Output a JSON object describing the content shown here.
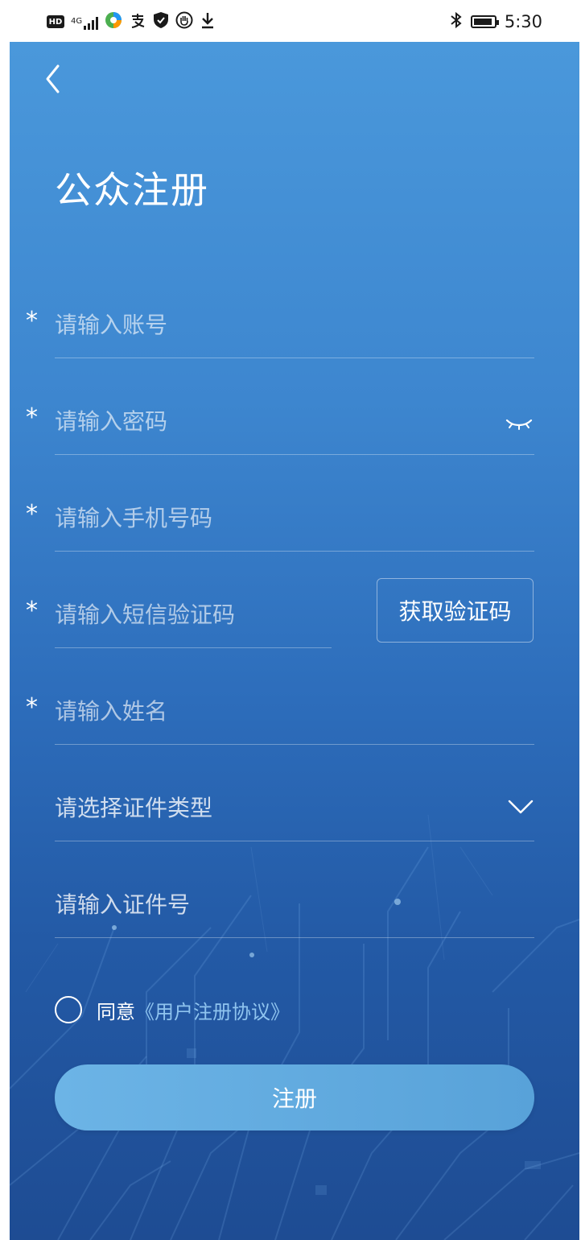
{
  "status_bar": {
    "hd_label": "HD",
    "network_label": "4G",
    "time": "5:30",
    "icons": [
      "hd-icon",
      "signal-icon",
      "app-icon",
      "alipay-icon",
      "shield-icon",
      "hand-icon",
      "download-icon",
      "bluetooth-icon",
      "battery-icon"
    ]
  },
  "header": {
    "back_icon": "chevron-left-icon",
    "title": "公众注册"
  },
  "form": {
    "required_mark": "*",
    "account_placeholder": "请输入账号",
    "password_placeholder": "请输入密码",
    "phone_placeholder": "请输入手机号码",
    "sms_placeholder": "请输入短信验证码",
    "get_code_label": "获取验证码",
    "name_placeholder": "请输入姓名",
    "id_type_placeholder": "请选择证件类型",
    "id_number_placeholder": "请输入证件号",
    "password_toggle_icon": "eye-closed-icon",
    "id_type_dropdown_icon": "chevron-down-icon"
  },
  "agreement": {
    "agree_label": "同意",
    "link_label": "《用户注册协议》",
    "checked": false
  },
  "submit": {
    "label": "注册"
  },
  "colors": {
    "background_top": "#4a98db",
    "background_bottom": "#1e4c93",
    "button": "#62abe0",
    "link": "#8fc4ef"
  }
}
